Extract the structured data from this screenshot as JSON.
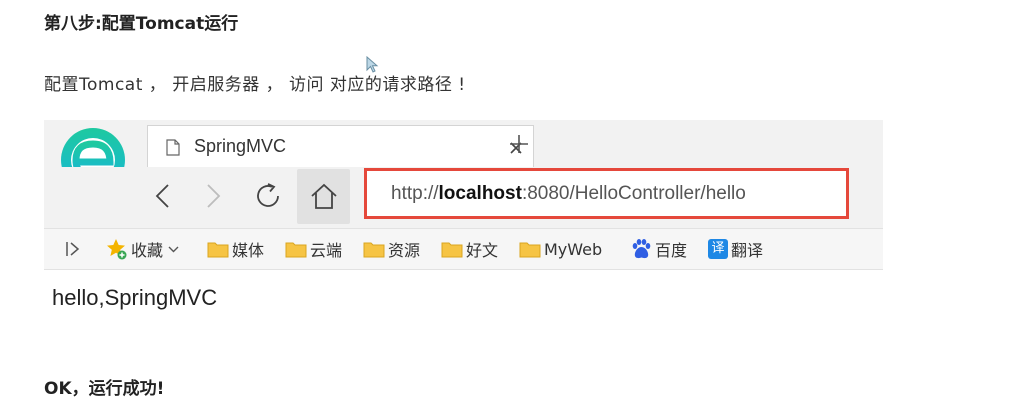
{
  "step_heading": "第八步:配置Tomcat运行",
  "paragraph": "配置Tomcat ，  开启服务器 ，  访问 对应的请求路径 !",
  "browser": {
    "tab_title": "SpringMVC",
    "url_prefix": "http://",
    "url_host": "localhost",
    "url_rest": ":8080/HelloController/hello",
    "bookmarks": [
      {
        "label": "收藏",
        "icon": "star-icon"
      },
      {
        "label": "媒体",
        "icon": "folder-icon"
      },
      {
        "label": "云端",
        "icon": "folder-icon"
      },
      {
        "label": "资源",
        "icon": "folder-icon"
      },
      {
        "label": "好文",
        "icon": "folder-icon"
      },
      {
        "label": "MyWeb",
        "icon": "folder-icon"
      },
      {
        "label": "百度",
        "icon": "baidu-paw-icon"
      },
      {
        "label": "翻译",
        "icon": "translate-icon",
        "icon_char": "译"
      }
    ],
    "page_text": "hello,SpringMVC",
    "accent_color": "#e5483b"
  },
  "result_text": "OK，运行成功!"
}
